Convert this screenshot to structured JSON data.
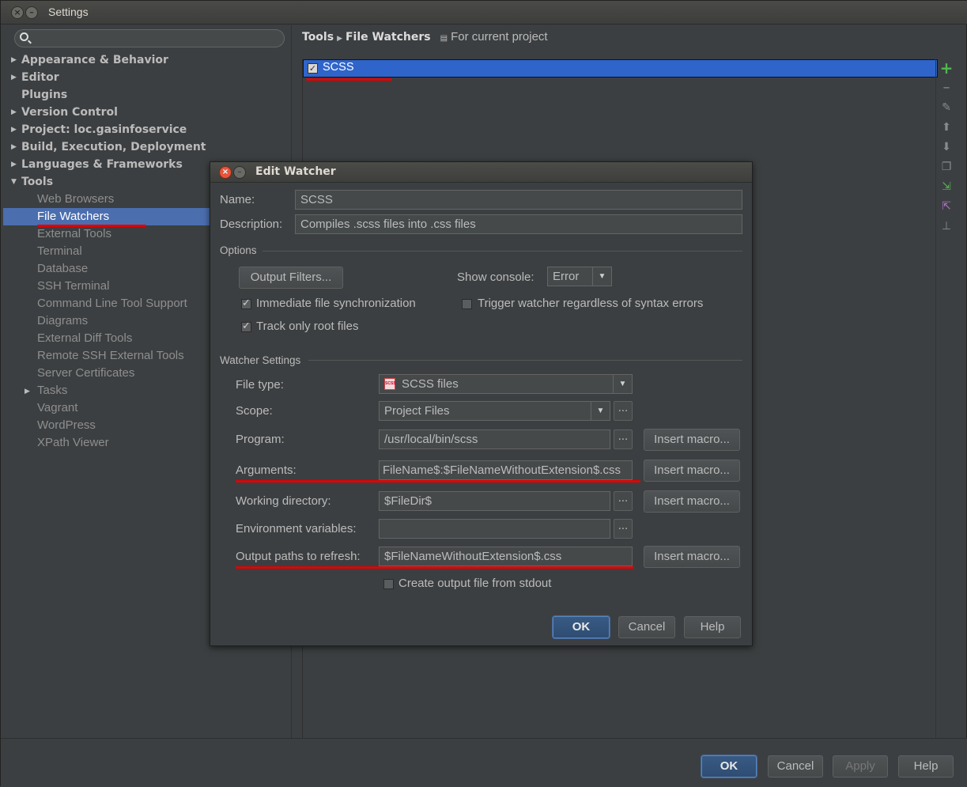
{
  "window": {
    "title": "Settings"
  },
  "search": {
    "placeholder": ""
  },
  "tree": {
    "items": [
      {
        "label": "Appearance & Behavior"
      },
      {
        "label": "Editor"
      },
      {
        "label": "Plugins"
      },
      {
        "label": "Version Control"
      },
      {
        "label": "Project: loc.gasinfoservice"
      },
      {
        "label": "Build, Execution, Deployment"
      },
      {
        "label": "Languages & Frameworks"
      },
      {
        "label": "Tools"
      }
    ],
    "tools_children": [
      {
        "label": "Web Browsers"
      },
      {
        "label": "File Watchers"
      },
      {
        "label": "External Tools"
      },
      {
        "label": "Terminal"
      },
      {
        "label": "Database"
      },
      {
        "label": "SSH Terminal"
      },
      {
        "label": "Command Line Tool Support"
      },
      {
        "label": "Diagrams"
      },
      {
        "label": "External Diff Tools"
      },
      {
        "label": "Remote SSH External Tools"
      },
      {
        "label": "Server Certificates"
      },
      {
        "label": "Tasks"
      },
      {
        "label": "Vagrant"
      },
      {
        "label": "WordPress"
      },
      {
        "label": "XPath Viewer"
      }
    ]
  },
  "breadcrumb": {
    "parent": "Tools",
    "current": "File Watchers",
    "scope": "For current project"
  },
  "watchers": {
    "items": [
      {
        "label": "SCSS",
        "enabled": true
      }
    ]
  },
  "dialog": {
    "title": "Edit Watcher",
    "name_label": "Name:",
    "name_value": "SCSS",
    "description_label": "Description:",
    "description_value": "Compiles .scss files into .css files",
    "options_section": "Options",
    "output_filters_button": "Output Filters...",
    "show_console_label": "Show console:",
    "show_console_value": "Error",
    "immediate_sync_label": "Immediate file synchronization",
    "trigger_watcher_label": "Trigger watcher regardless of syntax errors",
    "track_root_label": "Track only root files",
    "watcher_settings_section": "Watcher Settings",
    "file_type_label": "File type:",
    "file_type_value": "SCSS files",
    "file_type_icon_text": "SCSS",
    "scope_label": "Scope:",
    "scope_value": "Project Files",
    "program_label": "Program:",
    "program_value": "/usr/local/bin/scss",
    "arguments_label": "Arguments:",
    "arguments_value": "FileName$:$FileNameWithoutExtension$.css",
    "working_dir_label": "Working directory:",
    "working_dir_value": "$FileDir$",
    "env_vars_label": "Environment variables:",
    "env_vars_value": "",
    "output_paths_label": "Output paths to refresh:",
    "output_paths_value": "$FileNameWithoutExtension$.css",
    "create_output_label": "Create output file from stdout",
    "insert_macro_label": "Insert macro...",
    "dots_label": "...",
    "ok_label": "OK",
    "cancel_label": "Cancel",
    "help_label": "Help"
  },
  "footer": {
    "ok_label": "OK",
    "cancel_label": "Cancel",
    "apply_label": "Apply",
    "help_label": "Help"
  },
  "colors": {
    "selection": "#4b6eaf",
    "list_selection": "#2f65ca",
    "annotation_red": "#e00000"
  }
}
